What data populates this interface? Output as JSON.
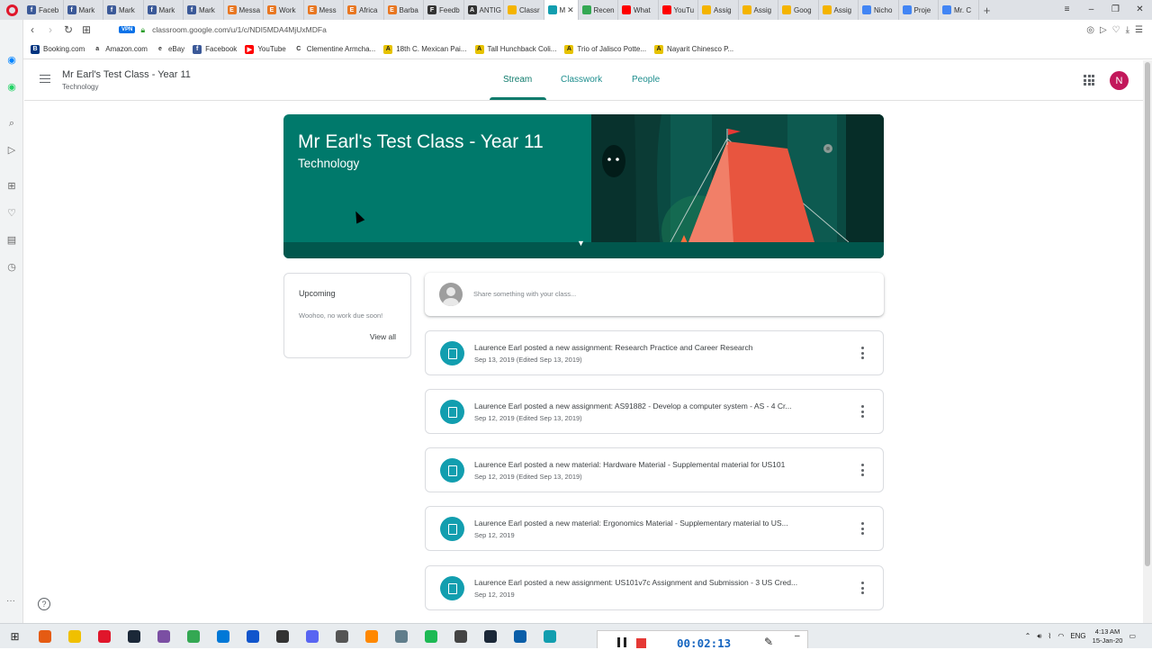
{
  "browser": {
    "tabs": [
      {
        "label": "Faceb",
        "color": "#3b5998",
        "glyph": "f"
      },
      {
        "label": "Mark",
        "color": "#3b5998",
        "glyph": "f"
      },
      {
        "label": "Mark",
        "color": "#3b5998",
        "glyph": "f"
      },
      {
        "label": "Mark",
        "color": "#3b5998",
        "glyph": "f"
      },
      {
        "label": "Mark",
        "color": "#3b5998",
        "glyph": "f"
      },
      {
        "label": "Messa",
        "color": "#e87722",
        "glyph": "E"
      },
      {
        "label": "Work",
        "color": "#e87722",
        "glyph": "E"
      },
      {
        "label": "Mess",
        "color": "#e87722",
        "glyph": "E"
      },
      {
        "label": "Africa",
        "color": "#e87722",
        "glyph": "E"
      },
      {
        "label": "Barba",
        "color": "#e87722",
        "glyph": "E"
      },
      {
        "label": "Feedb",
        "color": "#333333",
        "glyph": "F"
      },
      {
        "label": "ANTIG",
        "color": "#333333",
        "glyph": "A"
      },
      {
        "label": "Classr",
        "color": "#f4b400",
        "glyph": ""
      },
      {
        "label": "M",
        "color": "#129eaf",
        "glyph": "",
        "active": true
      },
      {
        "label": "Recen",
        "color": "#34a853",
        "glyph": ""
      },
      {
        "label": "What",
        "color": "#ff0000",
        "glyph": ""
      },
      {
        "label": "YouTu",
        "color": "#ff0000",
        "glyph": ""
      },
      {
        "label": "Assig",
        "color": "#f4b400",
        "glyph": ""
      },
      {
        "label": "Assig",
        "color": "#f4b400",
        "glyph": ""
      },
      {
        "label": "Goog",
        "color": "#f4b400",
        "glyph": ""
      },
      {
        "label": "Assig",
        "color": "#f4b400",
        "glyph": ""
      },
      {
        "label": "Nicho",
        "color": "#4285f4",
        "glyph": ""
      },
      {
        "label": "Proje",
        "color": "#4285f4",
        "glyph": ""
      },
      {
        "label": "Mr. C",
        "color": "#4285f4",
        "glyph": ""
      }
    ],
    "url": "classroom.google.com/u/1/c/NDI5MDA4MjUxMDFa",
    "vpn_label": "VPN",
    "bookmarks": [
      {
        "label": "Booking.com",
        "color": "#003580",
        "glyph": "B"
      },
      {
        "label": "Amazon.com",
        "color": "#ffffff",
        "glyph": "a"
      },
      {
        "label": "eBay",
        "color": "#ffffff",
        "glyph": "e"
      },
      {
        "label": "Facebook",
        "color": "#3b5998",
        "glyph": "f"
      },
      {
        "label": "YouTube",
        "color": "#ff0000",
        "glyph": "▶"
      },
      {
        "label": "Clementine Armcha...",
        "color": "#ffffff",
        "glyph": "C"
      },
      {
        "label": "18th C. Mexican Pai...",
        "color": "#e6c200",
        "glyph": "A"
      },
      {
        "label": "Tall Hunchback Coli...",
        "color": "#e6c200",
        "glyph": "A"
      },
      {
        "label": "Trio of Jalisco Potte...",
        "color": "#e6c200",
        "glyph": "A"
      },
      {
        "label": "Nayarit Chinesco P...",
        "color": "#e6c200",
        "glyph": "A"
      }
    ]
  },
  "classroom": {
    "class_name": "Mr Earl's Test Class - Year 11",
    "section": "Technology",
    "nav_tabs": [
      "Stream",
      "Classwork",
      "People"
    ],
    "active_tab": "Stream",
    "avatar_letter": "N",
    "accent_color": "#0f7b6c",
    "banner": {
      "title": "Mr Earl's Test Class - Year 11",
      "subtitle": "Technology"
    },
    "upcoming": {
      "title": "Upcoming",
      "message": "Woohoo, no work due soon!",
      "link": "View all"
    },
    "share_placeholder": "Share something with your class...",
    "posts": [
      {
        "title": "Laurence Earl posted a new assignment: Research Practice and Career Research",
        "date": "Sep 13, 2019 (Edited Sep 13, 2019)",
        "icon": "assignment-icon"
      },
      {
        "title": "Laurence Earl posted a new assignment: AS91882 - Develop a computer system - AS - 4 Cr...",
        "date": "Sep 12, 2019 (Edited Sep 13, 2019)",
        "icon": "assignment-icon"
      },
      {
        "title": "Laurence Earl posted a new material: Hardware Material - Supplemental material for US101",
        "date": "Sep 12, 2019 (Edited Sep 13, 2019)",
        "icon": "material-icon"
      },
      {
        "title": "Laurence Earl posted a new material: Ergonomics Material - Supplementary material to US...",
        "date": "Sep 12, 2019",
        "icon": "material-icon"
      },
      {
        "title": "Laurence Earl posted a new assignment: US101v7c Assignment and Submission - 3 US Cred...",
        "date": "Sep 12, 2019",
        "icon": "assignment-icon"
      }
    ]
  },
  "recorder": {
    "time": "00:02:13"
  },
  "taskbar": {
    "lang": "ENG",
    "time": "4:13 AM",
    "date": "15-Jan-20",
    "apps": [
      "#e55b13",
      "#f0c000",
      "#e0162b",
      "#1b2838",
      "#7b4fa3",
      "#34a853",
      "#0078d7",
      "#1155cc",
      "#333333",
      "#5865f2",
      "#555555",
      "#ff8800",
      "#607d8b",
      "#1db954",
      "#444444",
      "#1b2838",
      "#0a5ea8",
      "#129eaf"
    ]
  }
}
